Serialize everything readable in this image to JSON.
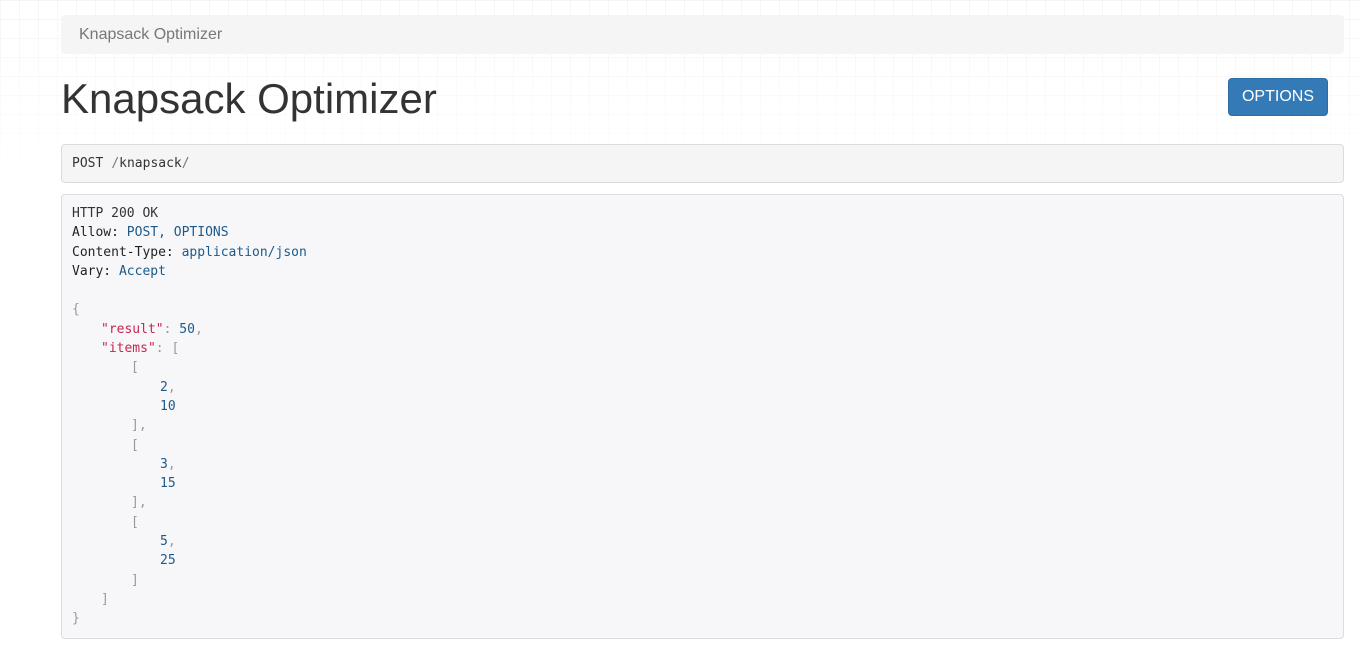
{
  "breadcrumb": {
    "label": "Knapsack Optimizer"
  },
  "header": {
    "title": "Knapsack Optimizer",
    "options_label": "OPTIONS"
  },
  "request": {
    "method": "POST",
    "path_prefix": "/",
    "path_segment": "knapsack",
    "path_suffix": "/"
  },
  "response": {
    "status": "HTTP 200 OK",
    "headers": [
      {
        "key": "Allow:",
        "value": "POST, OPTIONS"
      },
      {
        "key": "Content-Type:",
        "value": "application/json"
      },
      {
        "key": "Vary:",
        "value": "Accept"
      }
    ],
    "body": {
      "result_key": "\"result\"",
      "result_value": "50",
      "items_key": "\"items\"",
      "items": [
        [
          "2",
          "10"
        ],
        [
          "3",
          "15"
        ],
        [
          "5",
          "25"
        ]
      ]
    }
  },
  "colors": {
    "primary_button": "#337ab7",
    "json_string": "#c7254e",
    "json_number": "#1d5a8a"
  }
}
